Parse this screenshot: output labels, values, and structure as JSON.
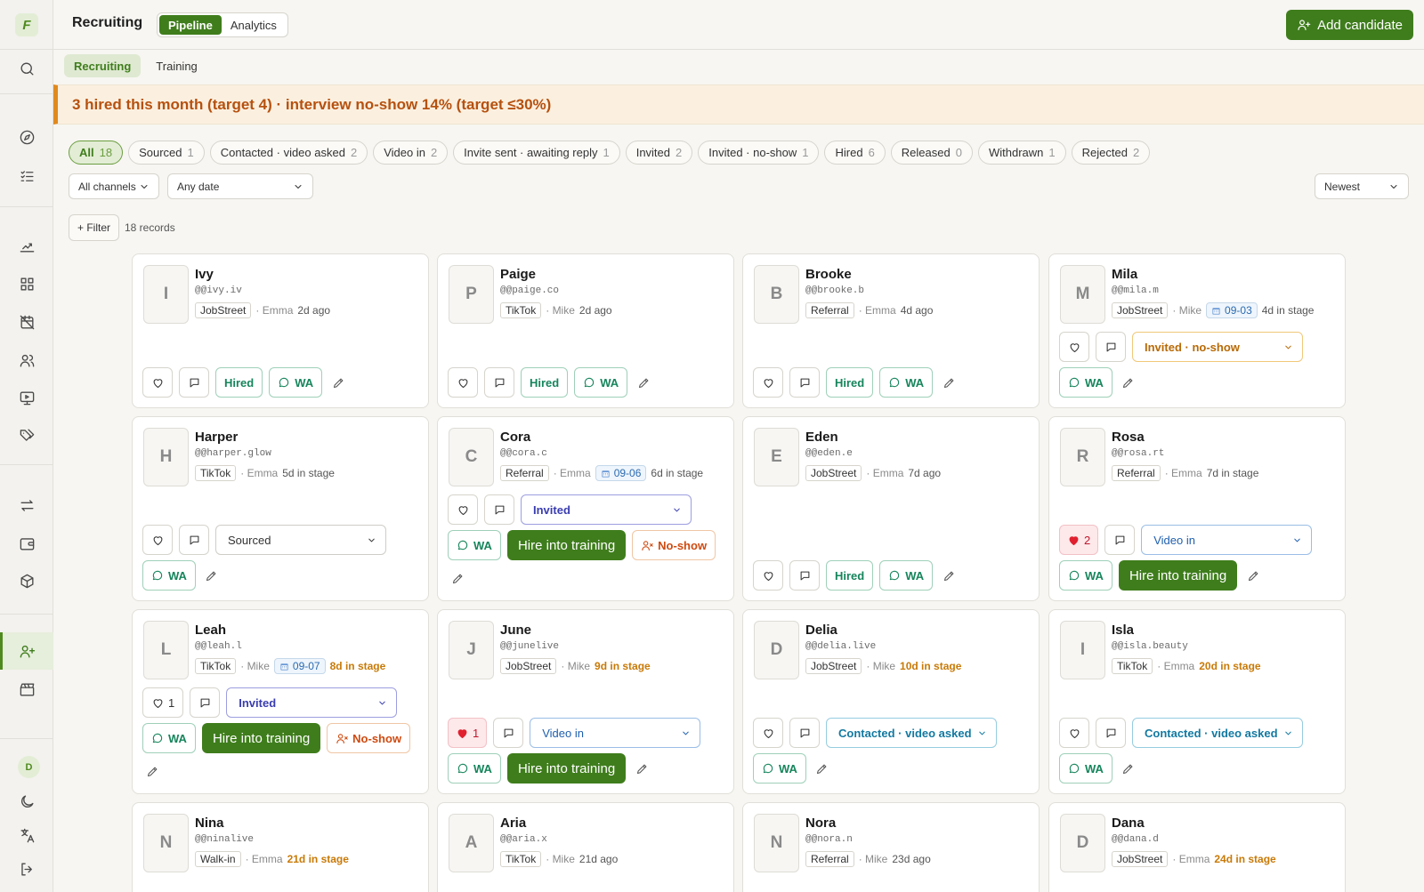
{
  "sidebar": {
    "logo": "F",
    "avatar": "D",
    "icons": [
      "search-icon",
      "compass-icon",
      "checklist-icon",
      "growth-icon",
      "grid-icon",
      "calendar-off-icon",
      "users-icon",
      "monitor-icon",
      "tags-icon",
      "swap-icon",
      "wallet-icon",
      "box-icon",
      "user-plus-icon",
      "clapperboard-icon",
      "moon-icon",
      "language-icon",
      "logout-icon"
    ]
  },
  "header": {
    "title": "Recruiting",
    "views": [
      "Pipeline",
      "Analytics"
    ],
    "add_label": "Add candidate"
  },
  "subtabs": [
    "Recruiting",
    "Training"
  ],
  "banner": "3 hired this month (target 4) · interview no-show 14% (target ≤30%)",
  "status_chips": [
    {
      "label": "All",
      "count": "18"
    },
    {
      "label": "Sourced",
      "count": "1"
    },
    {
      "label": "Contacted · video asked",
      "count": "2"
    },
    {
      "label": "Video in",
      "count": "2"
    },
    {
      "label": "Invite sent · awaiting reply",
      "count": "1"
    },
    {
      "label": "Invited",
      "count": "2"
    },
    {
      "label": "Invited · no-show",
      "count": "1"
    },
    {
      "label": "Hired",
      "count": "6"
    },
    {
      "label": "Released",
      "count": "0"
    },
    {
      "label": "Withdrawn",
      "count": "1"
    },
    {
      "label": "Rejected",
      "count": "2"
    }
  ],
  "filters": {
    "channel": "All channels",
    "date": "Any date",
    "sort": "Newest",
    "add_filter": "+ Filter",
    "records": "18 records"
  },
  "labels": {
    "hired": "Hired",
    "wa": "WA",
    "hire_training": "Hire into training",
    "no_show": "No-show"
  },
  "candidates": [
    {
      "initial": "I",
      "name": "Ivy",
      "handle": "@@ivy.iv",
      "source": "JobStreet",
      "owner": "· Emma",
      "age": "2d ago"
    },
    {
      "initial": "P",
      "name": "Paige",
      "handle": "@@paige.co",
      "source": "TikTok",
      "owner": "· Mike",
      "age": "2d ago"
    },
    {
      "initial": "B",
      "name": "Brooke",
      "handle": "@@brooke.b",
      "source": "Referral",
      "owner": "· Emma",
      "age": "4d ago"
    },
    {
      "initial": "M",
      "name": "Mila",
      "handle": "@@mila.m",
      "source": "JobStreet",
      "owner": "· Mike",
      "date": "09-03",
      "age": "4d in stage",
      "stage": "Invited · no-show"
    },
    {
      "initial": "H",
      "name": "Harper",
      "handle": "@@harper.glow",
      "source": "TikTok",
      "owner": "· Emma",
      "age": "5d in stage",
      "stage": "Sourced"
    },
    {
      "initial": "C",
      "name": "Cora",
      "handle": "@@cora.c",
      "source": "Referral",
      "owner": "· Emma",
      "date": "09-06",
      "age": "6d in stage",
      "stage": "Invited"
    },
    {
      "initial": "E",
      "name": "Eden",
      "handle": "@@eden.e",
      "source": "JobStreet",
      "owner": "· Emma",
      "age": "7d ago"
    },
    {
      "initial": "R",
      "name": "Rosa",
      "handle": "@@rosa.rt",
      "source": "Referral",
      "owner": "· Emma",
      "age": "7d in stage",
      "stage": "Video in",
      "likes": "2"
    },
    {
      "initial": "L",
      "name": "Leah",
      "handle": "@@leah.l",
      "source": "TikTok",
      "owner": "· Mike",
      "date": "09-07",
      "age": "8d in stage",
      "stage": "Invited",
      "likes": "1"
    },
    {
      "initial": "J",
      "name": "June",
      "handle": "@@junelive",
      "source": "JobStreet",
      "owner": "· Mike",
      "age": "9d in stage",
      "stage": "Video in",
      "likes": "1"
    },
    {
      "initial": "D",
      "name": "Delia",
      "handle": "@@delia.live",
      "source": "JobStreet",
      "owner": "· Mike",
      "age": "10d in stage",
      "stage": "Contacted · video asked"
    },
    {
      "initial": "I",
      "name": "Isla",
      "handle": "@@isla.beauty",
      "source": "TikTok",
      "owner": "· Emma",
      "age": "20d in stage",
      "stage": "Contacted · video asked"
    },
    {
      "initial": "N",
      "name": "Nina",
      "handle": "@@ninalive",
      "source": "Walk-in",
      "owner": "· Emma",
      "age": "21d in stage"
    },
    {
      "initial": "A",
      "name": "Aria",
      "handle": "@@aria.x",
      "source": "TikTok",
      "owner": "· Mike",
      "age": "21d ago"
    },
    {
      "initial": "N",
      "name": "Nora",
      "handle": "@@nora.n",
      "source": "Referral",
      "owner": "· Mike",
      "age": "23d ago"
    },
    {
      "initial": "D",
      "name": "Dana",
      "handle": "@@dana.d",
      "source": "JobStreet",
      "owner": "· Emma",
      "age": "24d in stage"
    }
  ]
}
